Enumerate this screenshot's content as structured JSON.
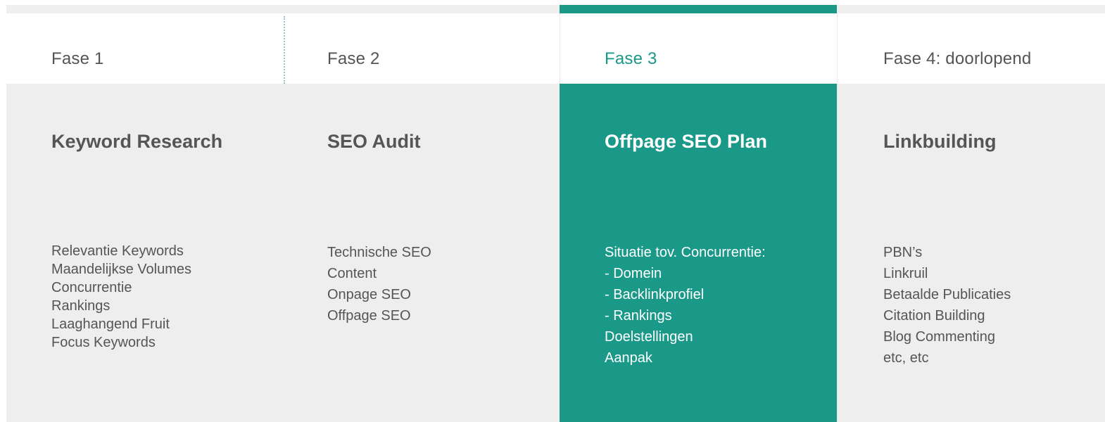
{
  "phases": [
    {
      "phase_label": "Fase 1",
      "title": "Keyword Research",
      "items": [
        "Relevantie Keywords",
        "Maandelijkse Volumes",
        "Concurrentie",
        "Rankings",
        "Laaghangend Fruit",
        "Focus Keywords"
      ]
    },
    {
      "phase_label": "Fase 2",
      "title": "SEO Audit",
      "items": [
        "Technische SEO",
        "Content",
        "Onpage SEO",
        "Offpage SEO"
      ]
    },
    {
      "phase_label": "Fase 3",
      "title": "Offpage SEO Plan",
      "items": [
        "Situatie tov. Concurrentie:",
        "- Domein",
        "- Backlinkprofiel",
        "- Rankings",
        "Doelstellingen",
        "Aanpak"
      ]
    },
    {
      "phase_label": "Fase 4: doorlopend",
      "title": "Linkbuilding",
      "items": [
        "PBN’s",
        "Linkruil",
        "Betaalde Publicaties",
        "Citation Building",
        "Blog Commenting",
        "etc, etc"
      ]
    }
  ],
  "active_phase_index": 2,
  "colors": {
    "accent": "#1a9988",
    "panel": "#eeeeee",
    "text": "#555555",
    "divider": "#8ec9cf"
  }
}
